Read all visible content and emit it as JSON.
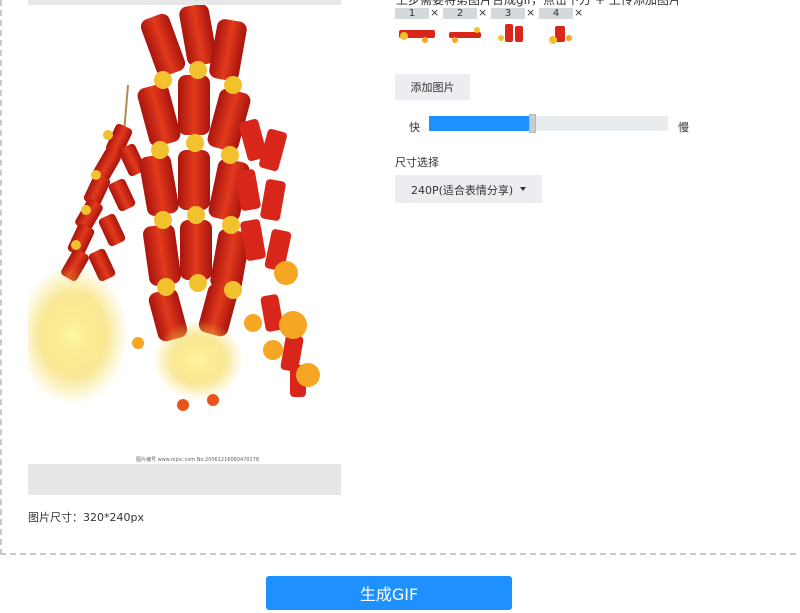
{
  "editor": {
    "hint": "上步需要将第图片合成gif，点击下方 + 上传添加图片",
    "thumbnails": [
      {
        "index": "1",
        "close": "×"
      },
      {
        "index": "2",
        "close": "×"
      },
      {
        "index": "3",
        "close": "×"
      },
      {
        "index": "4",
        "close": "×"
      }
    ],
    "add_label": "添加图片",
    "speed": {
      "fast_label": "快",
      "slow_label": "慢",
      "value_fraction": 0.42
    },
    "size_label": "尺寸选择",
    "size_selected": "240P(适合表情分享)"
  },
  "preview": {
    "watermark": "图片编号 www.nipic.com  No.20061216060470178",
    "size_text": "图片尺寸：320*240px"
  },
  "actions": {
    "generate_label": "生成GIF"
  },
  "colors": {
    "accent": "#1e90ff",
    "track": "#e9ecef",
    "button_bg": "#ebedf0",
    "firework_red": "#d8261a",
    "firework_gold": "#f2c12e"
  }
}
